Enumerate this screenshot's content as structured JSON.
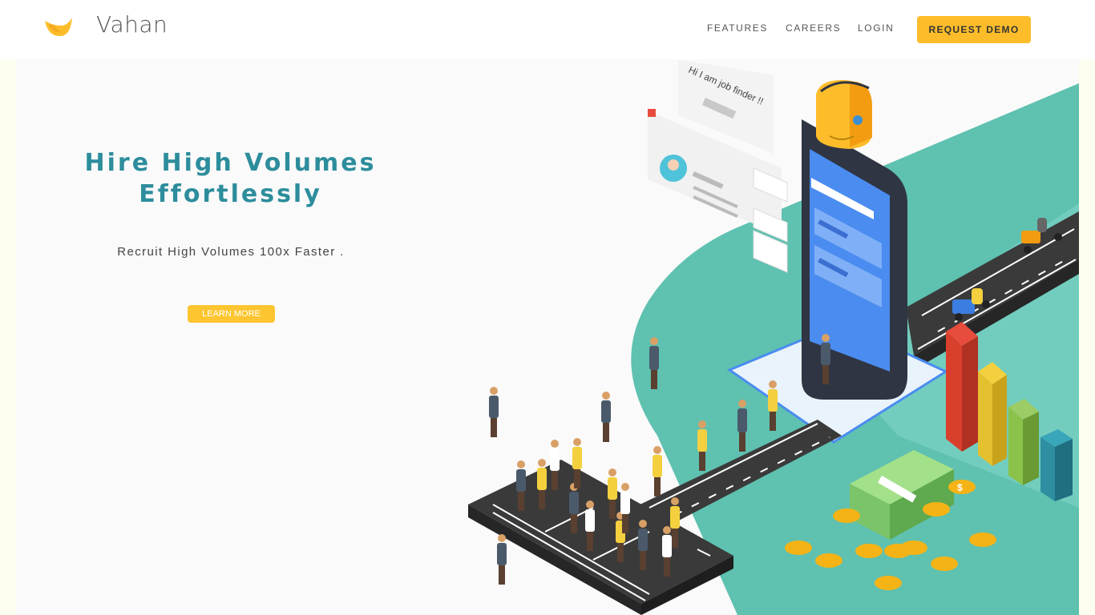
{
  "header": {
    "brand": "Vahan",
    "nav": {
      "features": "FEATURES",
      "careers": "CAREERS",
      "login": "LOGIN"
    },
    "cta": "REQUEST DEMO"
  },
  "hero": {
    "headline_line1": "Hire High Volumes",
    "headline_line2": "Effortlessly",
    "subheadline": "Recruit High Volumes 100x Faster .",
    "learn_more": "LEARN MORE"
  },
  "illustration": {
    "chat_bubble": "Hi I am job finder !!",
    "currency_symbol": "$"
  },
  "colors": {
    "accent_yellow": "#fdbd2b",
    "headline_teal": "#2d8d9c",
    "teal_bg": "#5fc1b0",
    "phone_blue": "#4a8cf0",
    "road": "#3a3a3a"
  }
}
